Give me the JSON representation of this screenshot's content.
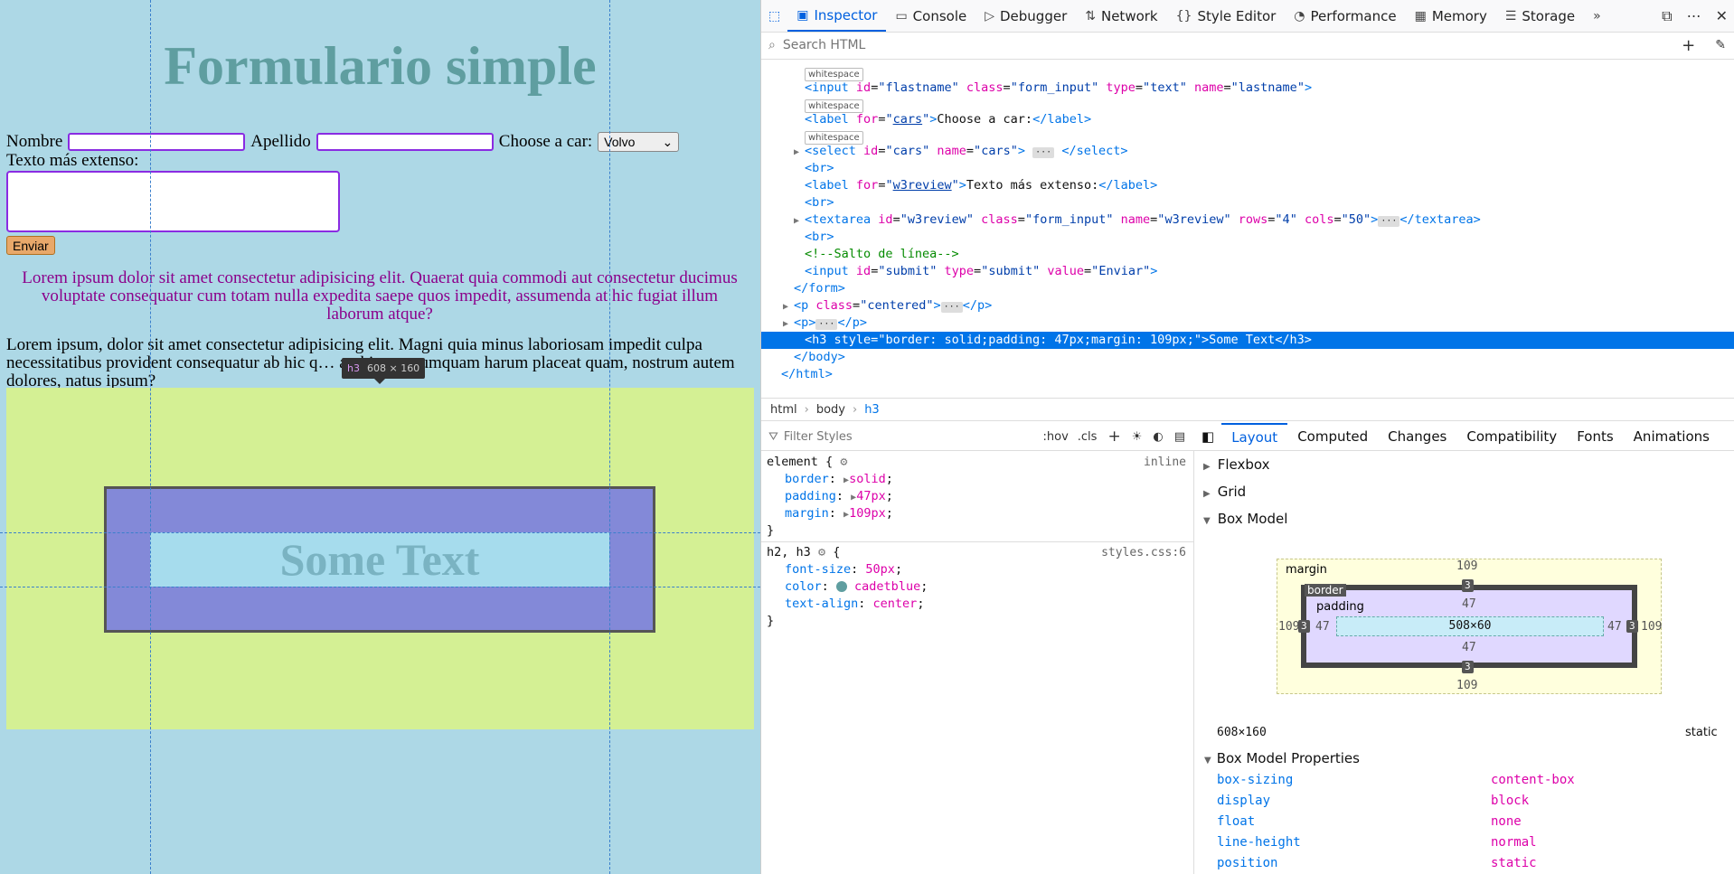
{
  "page": {
    "title": "Formulario simple",
    "label_nombre": "Nombre",
    "label_apellido": "Apellido",
    "label_car": "Choose a car:",
    "select_value": "Volvo",
    "label_textarea": "Texto más extenso:",
    "submit_label": "Enviar",
    "p_centered": "Lorem ipsum dolor sit amet consectetur adipisicing elit. Quaerat quia commodi aut consectetur ducimus voluptate consequatur cum totam nulla expedita saepe quos impedit, assumenda at hic fugiat illum laborum atque?",
    "p_normal": "Lorem ipsum, dolor sit amet consectetur adipisicing elit. Magni quia minus laboriosam impedit culpa necessitatibus provident consequatur ab hic q… architecto numquam harum placeat quam, nostrum autem dolores, natus ipsum?",
    "h3_text": "Some Text",
    "tooltip_tag": "h3",
    "tooltip_size": "608 × 160"
  },
  "devtools": {
    "tabs": [
      {
        "label": "Inspector",
        "icon": "inspector-icon"
      },
      {
        "label": "Console",
        "icon": "console-icon"
      },
      {
        "label": "Debugger",
        "icon": "debugger-icon"
      },
      {
        "label": "Network",
        "icon": "network-icon"
      },
      {
        "label": "Style Editor",
        "icon": "style-editor-icon"
      },
      {
        "label": "Performance",
        "icon": "performance-icon"
      },
      {
        "label": "Memory",
        "icon": "memory-icon"
      },
      {
        "label": "Storage",
        "icon": "storage-icon"
      }
    ],
    "search_placeholder": "Search HTML",
    "markup": {
      "ws": "whitespace",
      "input_lastname": {
        "id": "flastname",
        "class": "form_input",
        "type": "text",
        "name": "lastname"
      },
      "label_cars": {
        "for": "cars",
        "text": "Choose a car:"
      },
      "select_cars": {
        "id": "cars",
        "name": "cars"
      },
      "label_review": {
        "for": "w3review",
        "text": "Texto más extenso:"
      },
      "textarea": {
        "id": "w3review",
        "class": "form_input",
        "name": "w3review",
        "rows": "4",
        "cols": "50"
      },
      "comment": "<!--Salto de línea-->",
      "submit": {
        "id": "submit",
        "type": "submit",
        "value": "Enviar"
      },
      "p_class": "centered",
      "h3_style": "border: solid;padding: 47px;margin: 109px;",
      "h3_text": "Some Text"
    },
    "breadcrumbs": [
      "html",
      "body",
      "h3"
    ],
    "filter_styles_placeholder": "Filter Styles",
    "pseudo_label": ":hov",
    "cls_label": ".cls",
    "rules": {
      "element_selector": "element {",
      "element_source": "inline",
      "element_props": [
        {
          "name": "border",
          "value": "solid"
        },
        {
          "name": "padding",
          "value": "47px"
        },
        {
          "name": "margin",
          "value": "109px"
        }
      ],
      "h_selector": "h2, h3",
      "h_source": "styles.css:6",
      "h_props": [
        {
          "name": "font-size",
          "value": "50px"
        },
        {
          "name": "color",
          "value": "cadetblue"
        },
        {
          "name": "text-align",
          "value": "center"
        }
      ]
    },
    "layout_tabs": [
      "Layout",
      "Computed",
      "Changes",
      "Compatibility",
      "Fonts",
      "Animations"
    ],
    "sections": {
      "flexbox": "Flexbox",
      "grid": "Grid",
      "box_model": "Box Model",
      "box_model_props": "Box Model Properties"
    },
    "box_model": {
      "margin_label": "margin",
      "border_label": "border",
      "padding_label": "padding",
      "margin": "109",
      "border": "3",
      "padding": "47",
      "content": "508×60",
      "dimensions": "608×160",
      "position": "static"
    },
    "box_model_properties": [
      {
        "name": "box-sizing",
        "value": "content-box"
      },
      {
        "name": "display",
        "value": "block"
      },
      {
        "name": "float",
        "value": "none"
      },
      {
        "name": "line-height",
        "value": "normal"
      },
      {
        "name": "position",
        "value": "static"
      }
    ],
    "colors": {
      "accent": "#0060df",
      "selected_row": "#0074e8",
      "page_bg": "#add8e6",
      "h3_color": "#5f9ea0"
    }
  }
}
